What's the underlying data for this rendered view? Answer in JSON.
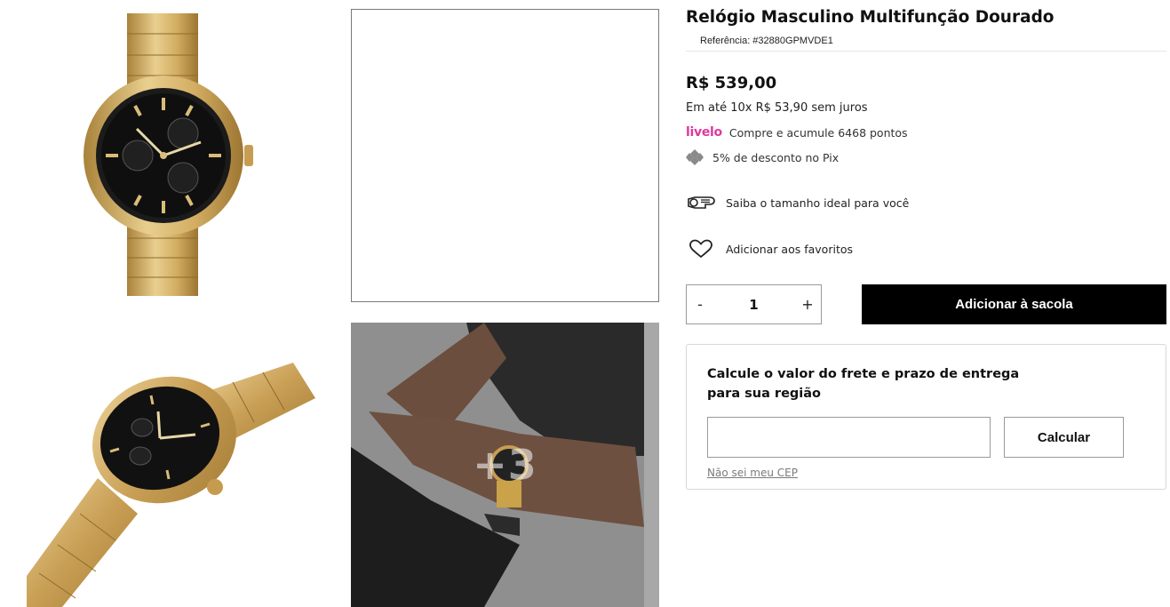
{
  "gallery": {
    "thumbnails": [
      {
        "icon": "watch-front-image"
      },
      {
        "icon": "blank-image"
      },
      {
        "icon": "watch-angle-image"
      },
      {
        "icon": "watch-on-wrist-image",
        "more_label": "+3"
      }
    ]
  },
  "product": {
    "title": "Relógio Masculino Multifunção Dourado",
    "reference": "Referência: #32880GPMVDE1",
    "price": "R$ 539,00",
    "installments": "Em até 10x R$ 53,90 sem juros",
    "livelo_logo": "livelo",
    "livelo_text": "Compre e acumule 6468 pontos",
    "pix_text": "5% de desconto no Pix",
    "size_text": "Saiba o tamanho ideal para você",
    "favorite_text": "Adicionar aos favoritos",
    "quantity": "1",
    "qty_minus": "-",
    "qty_plus": "+",
    "add_to_bag": "Adicionar à sacola"
  },
  "shipping": {
    "title": "Calcule o valor do frete e prazo de entrega para sua região",
    "cep_value": "",
    "calculate": "Calcular",
    "unknown_cep": "Não sei meu CEP"
  },
  "colors": {
    "livelo": "#e0389c",
    "primary_button": "#000000",
    "gold": "#c9a24a"
  }
}
